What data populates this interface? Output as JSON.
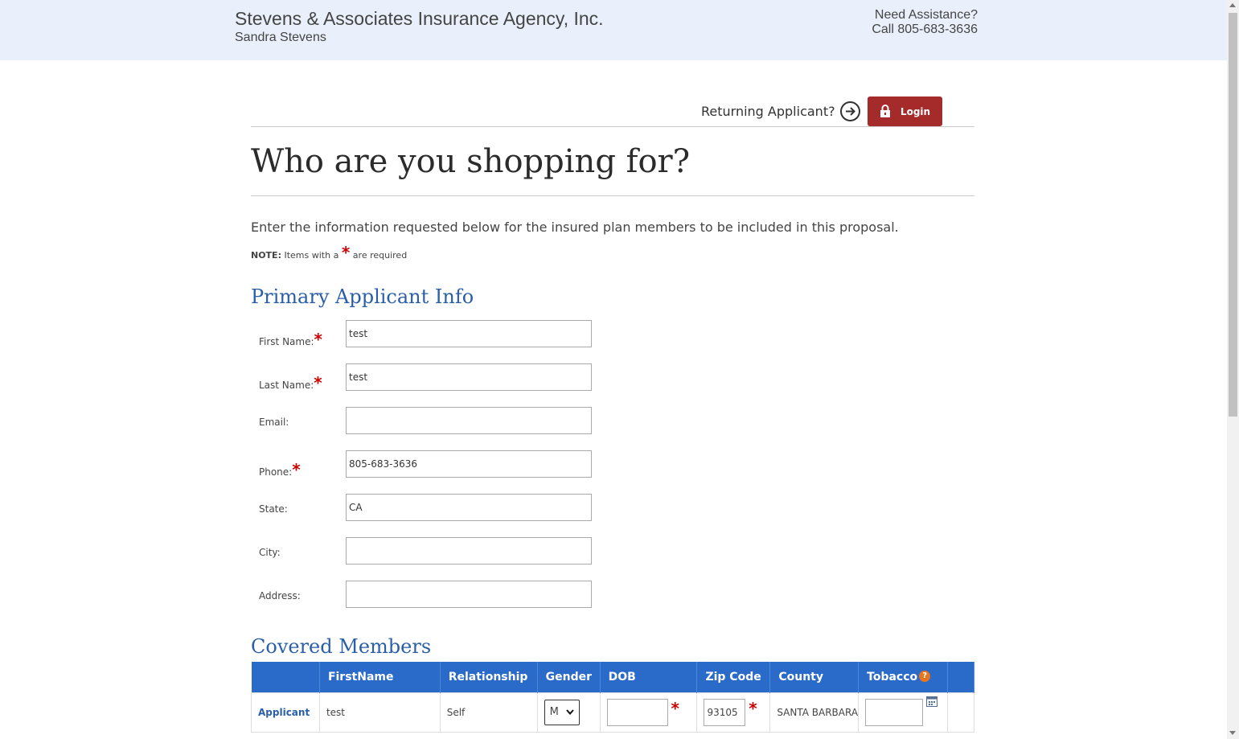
{
  "header": {
    "agency_name": "Stevens & Associates Insurance Agency, Inc.",
    "agent_name": "Sandra Stevens",
    "assist_line1": "Need Assistance?",
    "assist_line2": "Call 805-683-3636"
  },
  "login_bar": {
    "returning_text": "Returning Applicant?",
    "login_label": "Login"
  },
  "page": {
    "title": "Who are you shopping for?",
    "intro": "Enter the information requested below for the insured plan members to be included in this proposal.",
    "note_prefix": "NOTE:",
    "note_text1": "Items with a",
    "note_required_marker": "*",
    "note_text2": "are required"
  },
  "primary": {
    "section_title": "Primary Applicant Info",
    "fields": [
      {
        "label": "First Name:",
        "value": "test",
        "required": true
      },
      {
        "label": "Last Name:",
        "value": "test",
        "required": true
      },
      {
        "label": "Email:",
        "value": "",
        "required": false
      },
      {
        "label": "Phone:",
        "value": "805-683-3636",
        "required": true
      },
      {
        "label": "State:",
        "value": "CA",
        "required": false
      },
      {
        "label": "City:",
        "value": "",
        "required": false
      },
      {
        "label": "Address:",
        "value": "",
        "required": false
      }
    ]
  },
  "members": {
    "section_title": "Covered Members",
    "columns": [
      "",
      "FirstName",
      "Relationship",
      "Gender",
      "DOB",
      "Zip Code",
      "County",
      "Tobacco",
      ""
    ],
    "help_icon_glyph": "?",
    "rows": [
      {
        "type": "Applicant",
        "first_name": "test",
        "relationship": "Self",
        "gender": "M",
        "dob": "",
        "zip": "93105",
        "county": "SANTA BARBARA",
        "tobacco": ""
      }
    ]
  },
  "colors": {
    "topbar_bg": "#e9f0fb",
    "accent_blue": "#2a5fa8",
    "table_header": "#2a6bc9",
    "login_red": "#a52a2a",
    "required_red": "#cc0000"
  }
}
